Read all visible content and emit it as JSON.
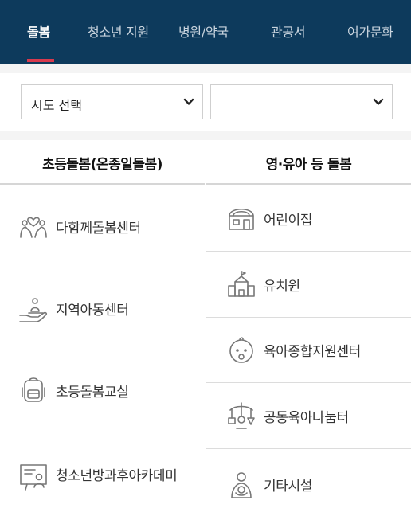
{
  "nav": {
    "tabs": [
      {
        "label": "돌봄",
        "active": true
      },
      {
        "label": "청소년 지원",
        "active": false
      },
      {
        "label": "병원/약국",
        "active": false
      },
      {
        "label": "관공서",
        "active": false
      },
      {
        "label": "여가문화",
        "active": false
      }
    ],
    "accent_color": "#d83a4e",
    "background_color": "#0d3a5c"
  },
  "filters": {
    "region_select": {
      "selected": "시도 선택",
      "icon": "chevron-down-icon"
    },
    "district_select": {
      "selected": "",
      "icon": "chevron-down-icon"
    }
  },
  "columns": {
    "left": {
      "title": "초등돌봄(온종일돌봄)",
      "items": [
        {
          "label": "다함께돌봄센터",
          "icon": "hands-heart-icon"
        },
        {
          "label": "지역아동센터",
          "icon": "hand-child-icon"
        },
        {
          "label": "초등돌봄교실",
          "icon": "backpack-icon"
        },
        {
          "label": "청소년방과후아카데미",
          "icon": "whiteboard-icon"
        }
      ]
    },
    "right": {
      "title": "영·유아 등 돌봄",
      "items": [
        {
          "label": "어린이집",
          "icon": "daycare-building-icon"
        },
        {
          "label": "유치원",
          "icon": "school-building-icon"
        },
        {
          "label": "육아종합지원센터",
          "icon": "baby-face-icon"
        },
        {
          "label": "공동육아나눔터",
          "icon": "baby-mobile-icon"
        },
        {
          "label": "기타시설",
          "icon": "people-hug-icon"
        }
      ]
    }
  }
}
